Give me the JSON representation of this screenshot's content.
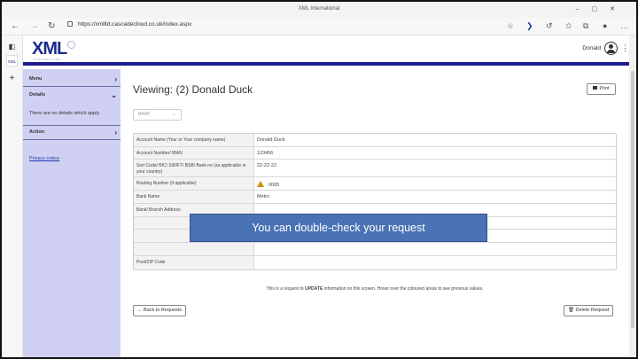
{
  "browser": {
    "window_title": "XML International",
    "url": "https://xmlltd.cascadecloud.co.uk/index.aspx",
    "vertical_tab_label": "XML"
  },
  "header": {
    "logo_text": "XML",
    "logo_subtitle": "International",
    "user_name": "Donald"
  },
  "sidebar": {
    "menu_label": "Menu",
    "details_label": "Details",
    "details_text": "There are no details which apply.",
    "action_label": "Action",
    "privacy_link": "Privacy notice"
  },
  "main": {
    "viewing_title": "Viewing:  (2) Donald Duck",
    "print_label": "Print",
    "select_value": "BANK",
    "rows": [
      {
        "label": "Account Name (Your or Your company name)",
        "value": "Donald Duck",
        "warning": false
      },
      {
        "label": "Account Number/ IBAN",
        "value": "123456",
        "warning": false
      },
      {
        "label": "Sort Code/ BIC/ SWIFT/ BSB/ Bank no (as applicable in your country)",
        "value": "22-22-22",
        "warning": false
      },
      {
        "label": "Routing Number (if applicable)",
        "value": "0005",
        "warning": true
      },
      {
        "label": "Bank Name",
        "value": "Metro",
        "warning": false
      },
      {
        "label": "Bank/ Branch Address",
        "value": "",
        "warning": false
      },
      {
        "label": "",
        "value": "",
        "warning": false
      },
      {
        "label": "",
        "value": "",
        "warning": false
      },
      {
        "label": "",
        "value": "",
        "warning": false
      },
      {
        "label": "Post/ZIP Code",
        "value": "",
        "warning": false
      }
    ],
    "note_pre": "This is a request to ",
    "note_bold": "UPDATE",
    "note_post": " information on this screen. Hover over the coloured areas to see previous values.",
    "back_button": "Back to Requests",
    "delete_button": "Delete Request"
  },
  "overlay": {
    "text": "You can double-check your request",
    "color": "#4a73b5"
  },
  "colors": {
    "header_rule": "#1c1c8c",
    "sidebar_bg": "#cfd0f2",
    "warning": "#d08a10"
  }
}
